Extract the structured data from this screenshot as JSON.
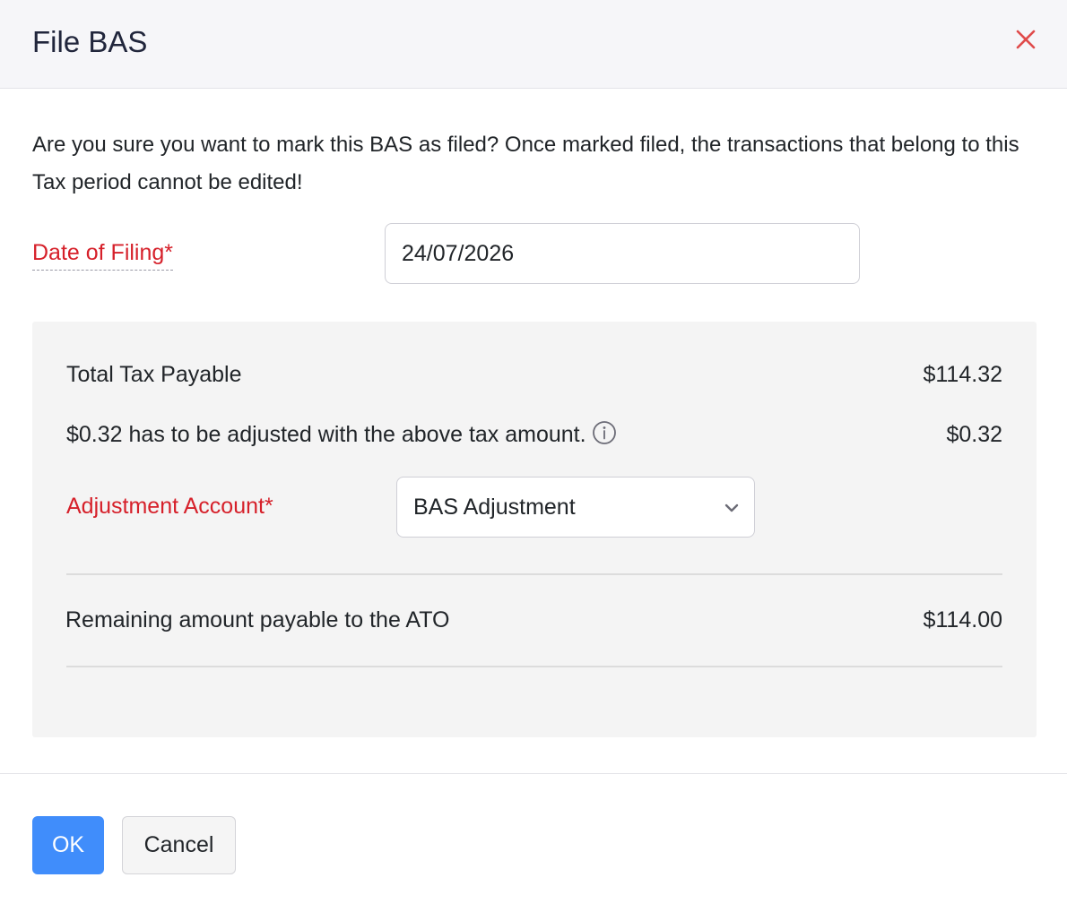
{
  "header": {
    "title": "File BAS",
    "close_icon": "close-icon",
    "close_color": "#e04b4b"
  },
  "confirm_message": "Are you sure you want to mark this BAS as filed? Once marked filed, the transactions that belong to this Tax period cannot be edited!",
  "date_of_filing": {
    "label": "Date of Filing*",
    "value": "24/07/2026"
  },
  "summary": {
    "total_tax_payable": {
      "label": "Total Tax Payable",
      "amount": "$114.32"
    },
    "adjustment_note": {
      "label": "$0.32 has to be adjusted with the above tax amount.",
      "amount": "$0.32",
      "icon": "info-icon"
    },
    "adjustment_account": {
      "label": "Adjustment Account*",
      "selected": "BAS Adjustment",
      "icon": "chevron-down-icon"
    },
    "remaining": {
      "label": "Remaining amount payable to the ATO",
      "amount": "$114.00"
    }
  },
  "footer": {
    "ok_label": "OK",
    "cancel_label": "Cancel"
  },
  "colors": {
    "accent": "#408dfb",
    "required_label": "#d6202a",
    "header_bg": "#f6f6f9",
    "panel_bg": "#f4f4f4"
  }
}
